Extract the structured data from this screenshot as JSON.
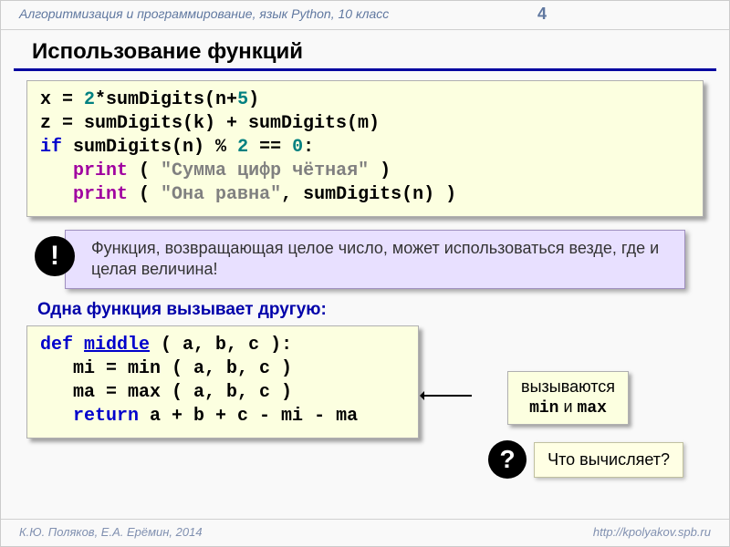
{
  "header": {
    "course": "Алгоритмизация и программирование, язык Python, 10 класс",
    "page": "4"
  },
  "title": "Использование функций",
  "code1": {
    "l1a": "x = ",
    "l1b": "2",
    "l1c": "*sumDigits(n+",
    "l1d": "5",
    "l1e": ")",
    "l2": "z = sumDigits(k) + sumDigits(m)",
    "l3a": "if",
    "l3b": " sumDigits(n) ",
    "l3c": "%",
    "l3d": " ",
    "l3e": "2",
    "l3f": " == ",
    "l3g": "0",
    "l3h": ":",
    "l4a": "   ",
    "l4b": "print",
    "l4c": " ( ",
    "l4d": "\"Сумма цифр чётная\"",
    "l4e": " )",
    "l5a": "   ",
    "l5b": "print",
    "l5c": " ( ",
    "l5d": "\"Она равна\"",
    "l5e": ", sumDigits(n) )"
  },
  "note": {
    "mark": "!",
    "text": "Функция, возвращающая целое число, может использоваться везде, где и целая величина!"
  },
  "subheading": "Одна функция вызывает другую:",
  "code2": {
    "l1a": "def",
    "l1b": " ",
    "l1c": "middle",
    "l1d": " ( a, b, c ):",
    "l2": "   mi = min ( a, b, c )",
    "l3": "   ma = max ( a, b, c )",
    "l4a": "   ",
    "l4b": "return",
    "l4c": " a + b + c - mi - ma"
  },
  "sidelabel": {
    "line1": "вызываются",
    "m1": "min",
    "and": " и ",
    "m2": "max"
  },
  "question": {
    "mark": "?",
    "text": "Что вычисляет?"
  },
  "footer": {
    "left": "К.Ю. Поляков, Е.А. Ерёмин, 2014",
    "right": "http://kpolyakov.spb.ru"
  }
}
